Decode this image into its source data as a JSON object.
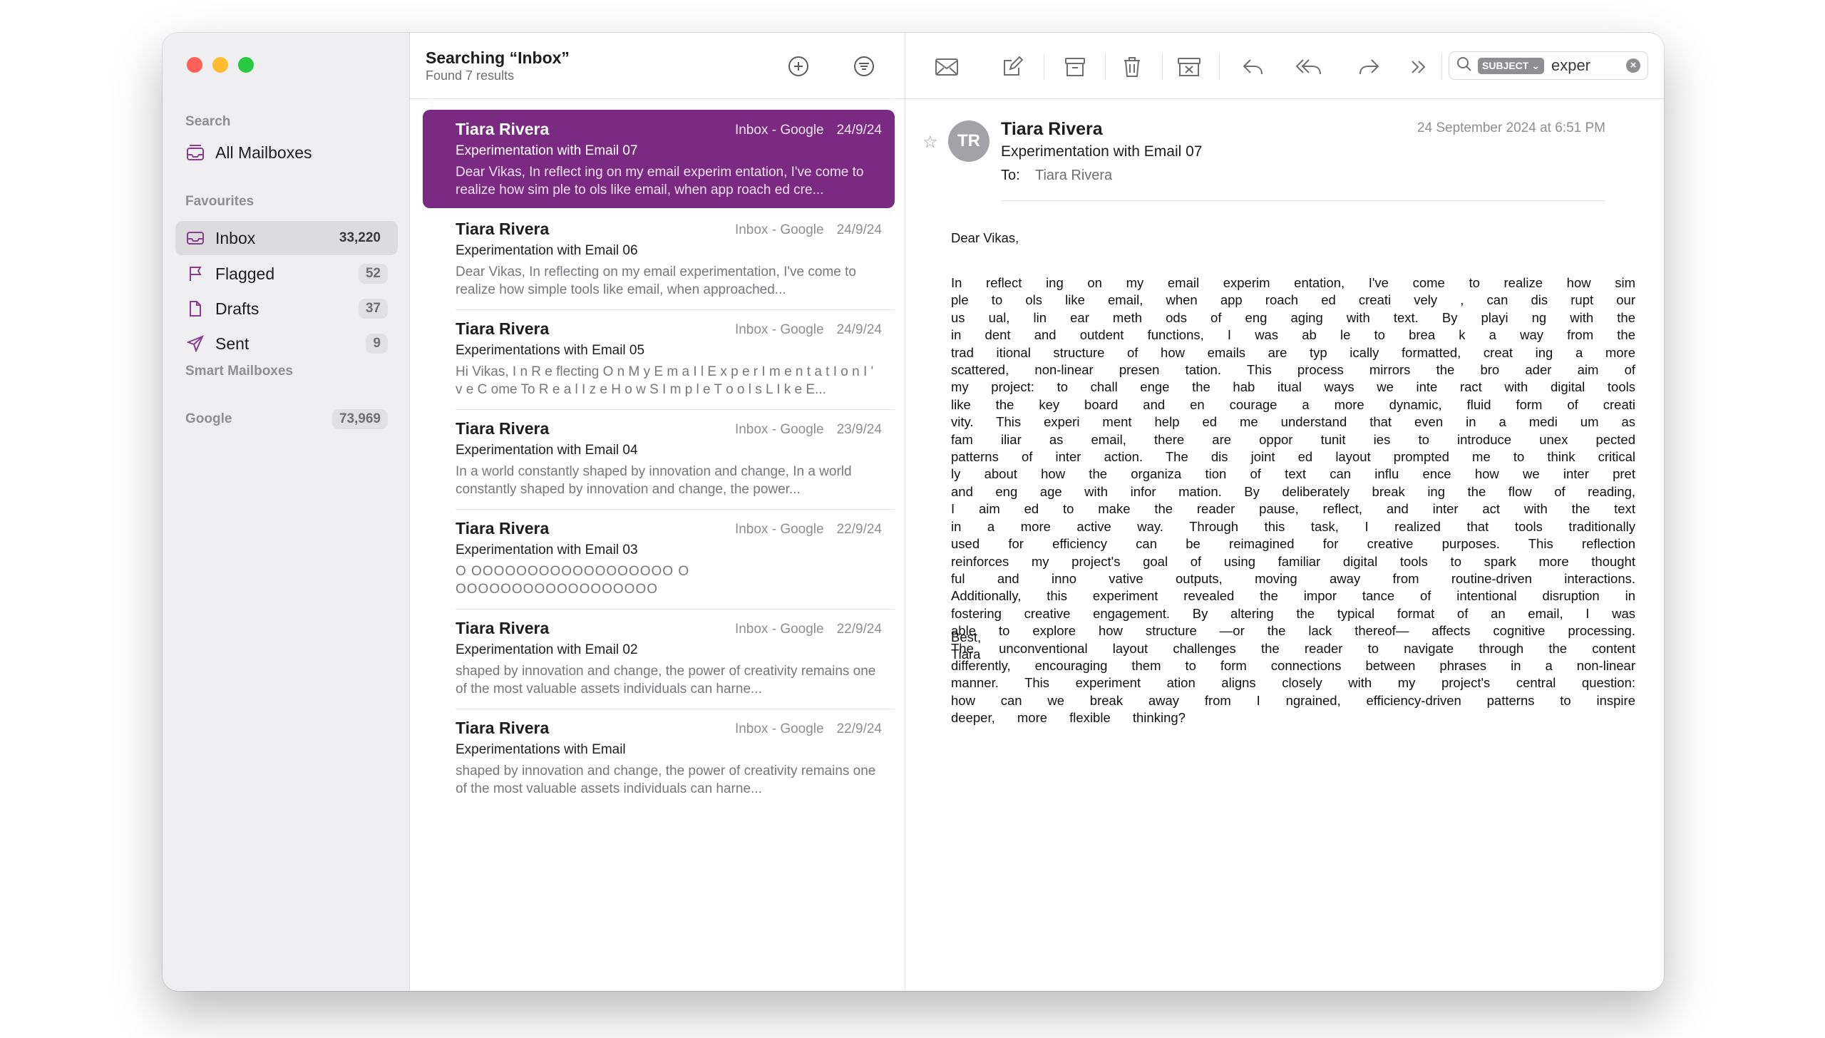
{
  "sidebar": {
    "search_section": "Search",
    "all_mailboxes": "All Mailboxes",
    "favourites_section": "Favourites",
    "items": [
      {
        "label": "Inbox",
        "count": "33,220"
      },
      {
        "label": "Flagged",
        "count": "52"
      },
      {
        "label": "Drafts",
        "count": "37"
      },
      {
        "label": "Sent",
        "count": "9"
      }
    ],
    "smart_mailboxes_section": "Smart Mailboxes",
    "google": {
      "label": "Google",
      "count": "73,969"
    }
  },
  "list": {
    "title": "Searching “Inbox”",
    "subtitle": "Found 7 results",
    "messages": [
      {
        "sender": "Tiara Rivera",
        "mailbox": "Inbox - Google",
        "date": "24/9/24",
        "subject": "Experimentation with Email 07",
        "preview": "Dear Vikas, In reflect ing on my email experim entation, I've come to realize how sim ple to ols like email, when app roach ed cre..."
      },
      {
        "sender": "Tiara Rivera",
        "mailbox": "Inbox - Google",
        "date": "24/9/24",
        "subject": "Experimentation with Email 06",
        "preview": "Dear Vikas, In reflecting on my email experimentation, I've come to realize how simple tools like email, when approached..."
      },
      {
        "sender": "Tiara Rivera",
        "mailbox": "Inbox - Google",
        "date": "24/9/24",
        "subject": "Experimentations with Email 05",
        "preview": "Hi Vikas, I n R e flecting O n M y E m a I l E x p e r I m e n t a t I o n I ' v e C ome To R e a l I z e H o w S I m p l e T o o l s L I k e E..."
      },
      {
        "sender": "Tiara Rivera",
        "mailbox": "Inbox - Google",
        "date": "23/9/24",
        "subject": "Experimentation with Email 04",
        "preview": "In a world constantly shaped by innovation and change, In a world constantly shaped by innovation and change, the power..."
      },
      {
        "sender": "Tiara Rivera",
        "mailbox": "Inbox - Google",
        "date": "22/9/24",
        "subject": "Experimentation with Email 03",
        "preview": "O OOOOOOOOOOOOOOOOOO O OOOOOOOOOOOOOOOOOO"
      },
      {
        "sender": "Tiara Rivera",
        "mailbox": "Inbox - Google",
        "date": "22/9/24",
        "subject": "Experimentation with Email 02",
        "preview": "shaped by innovation and change, the power of creativity remains one of the most valuable assets individuals can harne..."
      },
      {
        "sender": "Tiara Rivera",
        "mailbox": "Inbox - Google",
        "date": "22/9/24",
        "subject": "Experimentations with Email",
        "preview": "shaped by innovation and change, the power of creativity remains one of the most valuable assets individuals can harne..."
      }
    ]
  },
  "toolbar": {
    "search_token": "SUBJECT ⌄",
    "search_value": "exper",
    "clear": "×"
  },
  "reader": {
    "avatar_initials": "TR",
    "from": "Tiara Rivera",
    "subject": "Experimentation with Email 07",
    "to_label": "To:",
    "to": "Tiara Rivera",
    "date": "24 September 2024 at 6:51 PM",
    "greeting": "Dear Vikas,",
    "body": "In reflect ing on my email experim entation, I've come to realize how sim ple to ols like email, when app roach ed creati vely , can dis rupt our us ual, lin ear meth ods of eng aging with text. By playi ng with the in dent and outdent functions, I was ab le to brea k a way from the trad itional structure of how emails are typ ically formatted, creat ing a more scattered, non-linear presen tation. This process mirrors the bro ader aim of my project: to chall enge the hab itual ways we inte ract with digital tools like the key board and en courage a more dynamic, fluid form of creati vity. This experi ment help ed me understand that even in a medi um as fam iliar as email, there are oppor tunit ies to introduce unex pected patterns of inter action. The dis joint ed layout prompted me to think critical ly about how the organiza tion of text can influ ence how we inter pret and eng age with infor mation. By deliberately break ing the flow of reading, I aim ed to make the reader pause, reflect, and inter act with the text in a more active way. Through this task, I realized that tools traditionally used for efficiency can be reimagined for creative purposes. This reflection reinforces my project's goal of using familiar digital tools to spark more thought ful and inno vative outputs, moving away from routine-driven interactions. Additionally, this experiment revealed the impor tance of intentional disruption in fostering creative engagement. By altering the typical format of an email, I was able to explore how structure —or the lack thereof— affects cognitive processing. The unconventional layout challenges the reader to navigate through the content differently, encouraging them to form connections between phrases in a non-linear manner. This experiment ation aligns closely with my project's central question: how can we break away from I ngrained, efficiency-driven patterns to inspire deeper, more flexible thinking?",
    "sign_off": "Best,",
    "signature": "Tiara"
  },
  "colors": {
    "accent": "#7a2a81",
    "sidebar_icon": "#8a3c8f",
    "sidebar_bg": "#efeff1"
  }
}
